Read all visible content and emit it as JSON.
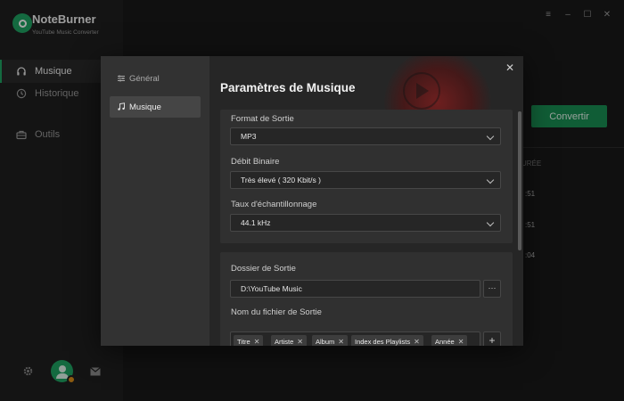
{
  "app": {
    "name": "NoteBurner",
    "subtitle": "YouTube Music Converter"
  },
  "sidebar": {
    "items": [
      {
        "label": "Musique",
        "icon": "headphones-icon",
        "active": true
      },
      {
        "label": "Historique",
        "icon": "clock-icon",
        "active": false
      },
      {
        "label": "Outils",
        "icon": "toolbox-icon",
        "active": false
      }
    ]
  },
  "window_controls": {
    "menu": "≡",
    "minimize": "–",
    "maximize": "☐",
    "close": "✕"
  },
  "background": {
    "convert_label": "Convertir",
    "column_header": "URÉE",
    "durations": [
      ":51",
      ":51",
      ":04"
    ]
  },
  "dialog": {
    "title": "Paramètres de Musique",
    "tabs": [
      {
        "label": "Général",
        "icon": "sliders-icon",
        "active": false
      },
      {
        "label": "Musique",
        "icon": "music-note-icon",
        "active": true
      }
    ],
    "output_format": {
      "label": "Format de Sortie",
      "value": "MP3"
    },
    "bitrate": {
      "label": "Débit Binaire",
      "value": "Très élevé ( 320 Kbit/s )"
    },
    "sample_rate": {
      "label": "Taux d'échantillonnage",
      "value": "44.1 kHz"
    },
    "output_folder": {
      "label": "Dossier de Sortie",
      "value": "D:\\YouTube Music",
      "browse": "···"
    },
    "filename": {
      "label": "Nom du fichier de Sortie",
      "tags": [
        "Titre",
        "Artiste",
        "Album",
        "Index des Playlists",
        "Année"
      ],
      "add": "+"
    },
    "close": "✕"
  },
  "colors": {
    "accent": "#1fa463",
    "convert": "#1a8f53",
    "dialog_bg": "#262626"
  }
}
